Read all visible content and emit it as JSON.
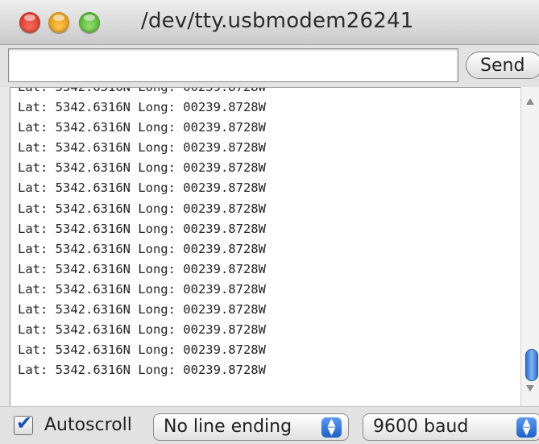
{
  "window": {
    "title": "/dev/tty.usbmodem26241"
  },
  "toolbar": {
    "input_value": "",
    "send_label": "Send"
  },
  "output": {
    "lines": [
      "Lat: 5342.6316N Long: 00239.8728W",
      "Lat: 5342.6316N Long: 00239.8728W",
      "Lat: 5342.6316N Long: 00239.8728W",
      "Lat: 5342.6316N Long: 00239.8728W",
      "Lat: 5342.6316N Long: 00239.8728W",
      "Lat: 5342.6316N Long: 00239.8728W",
      "Lat: 5342.6316N Long: 00239.8728W",
      "Lat: 5342.6316N Long: 00239.8728W",
      "Lat: 5342.6316N Long: 00239.8728W",
      "Lat: 5342.6316N Long: 00239.8728W",
      "Lat: 5342.6316N Long: 00239.8728W",
      "Lat: 5342.6316N Long: 00239.8728W",
      "Lat: 5342.6316N Long: 00239.8728W",
      "Lat: 5342.6316N Long: 00239.8728W",
      "Lat: 5342.6316N Long: 00239.8728W"
    ]
  },
  "footer": {
    "autoscroll_label": "Autoscroll",
    "autoscroll_checked": true,
    "checkmark": "✔",
    "line_ending": "No line ending",
    "baud": "9600 baud",
    "stepper": "▲\n▼"
  },
  "colors": {
    "close": "#e0443a",
    "minimize": "#f2a927",
    "maximize": "#5cbb3b",
    "accent": "#2d6fd1"
  }
}
